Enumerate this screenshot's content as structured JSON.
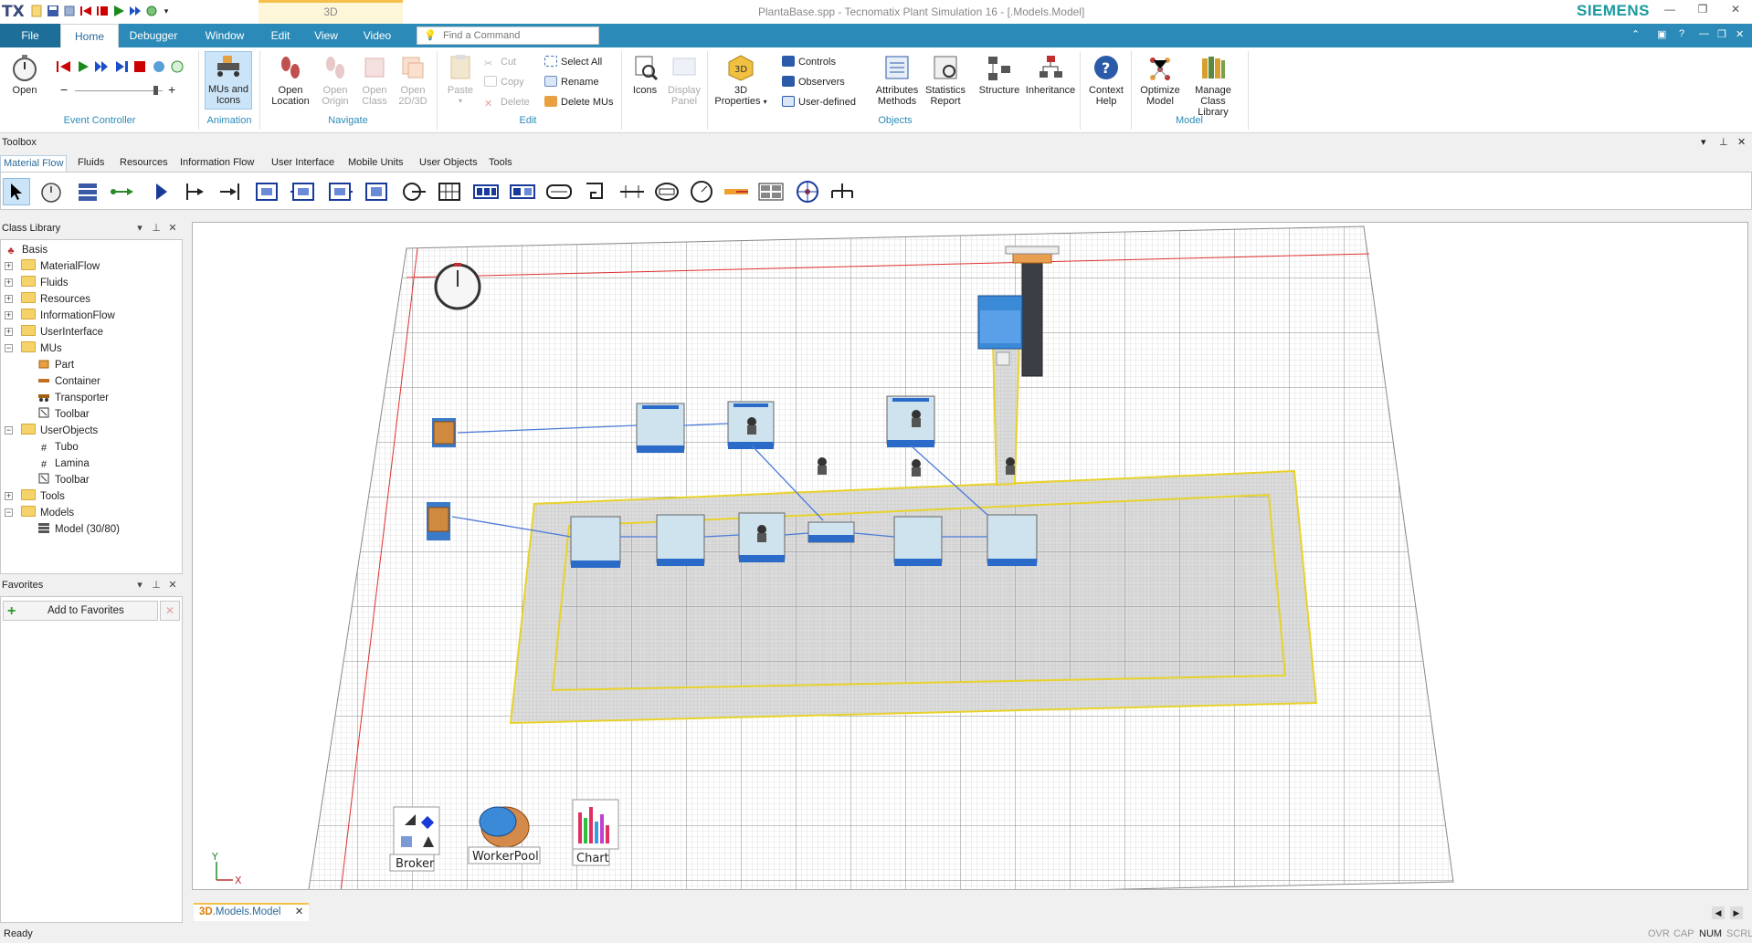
{
  "titlebar": {
    "app_logo": "TX",
    "context_tab": "3D",
    "window_title": "PlantaBase.spp - Tecnomatix Plant Simulation 16 - [.Models.Model]",
    "brand": "SIEMENS",
    "buttons": [
      "minimize",
      "maximize",
      "close"
    ]
  },
  "ribbon_tabs": [
    {
      "label": "File"
    },
    {
      "label": "Home"
    },
    {
      "label": "Debugger"
    },
    {
      "label": "Window"
    },
    {
      "label": "Edit"
    },
    {
      "label": "View"
    },
    {
      "label": "Video"
    }
  ],
  "find_command": {
    "placeholder": "Find a Command"
  },
  "ribbon": {
    "event_controller": {
      "open_label": "Open",
      "group_label": "Event Controller"
    },
    "animation": {
      "mus_label_1": "MUs and",
      "mus_label_2": "Icons",
      "group_label": "Animation"
    },
    "navigate": {
      "open_location_1": "Open",
      "open_location_2": "Location",
      "open_origin_1": "Open",
      "open_origin_2": "Origin",
      "open_class_1": "Open",
      "open_class_2": "Class",
      "open_2d3d_1": "Open",
      "open_2d3d_2": "2D/3D",
      "group_label": "Navigate"
    },
    "edit": {
      "paste": "Paste",
      "cut": "Cut",
      "copy": "Copy",
      "delete": "Delete",
      "select_all": "Select All",
      "rename": "Rename",
      "delete_mus": "Delete MUs",
      "group_label": "Edit"
    },
    "icons_group": {
      "icons": "Icons",
      "display_panel_1": "Display",
      "display_panel_2": "Panel"
    },
    "objects": {
      "props_1": "3D",
      "props_2": "Properties",
      "controls": "Controls",
      "observers": "Observers",
      "user_defined": "User-defined",
      "attr_1": "Attributes",
      "attr_2": "Methods",
      "stats_1": "Statistics",
      "stats_2": "Report",
      "structure": "Structure",
      "inheritance": "Inheritance",
      "group_label": "Objects"
    },
    "help": {
      "ctx_1": "Context",
      "ctx_2": "Help"
    },
    "model": {
      "opt_1": "Optimize",
      "opt_2": "Model",
      "mcl_1": "Manage",
      "mcl_2": "Class Library",
      "group_label": "Model"
    }
  },
  "toolbox": {
    "title": "Toolbox",
    "tabs": [
      "Material Flow",
      "Fluids",
      "Resources",
      "Information Flow",
      "User Interface",
      "Mobile Units",
      "User Objects",
      "Tools"
    ]
  },
  "class_library": {
    "title": "Class Library",
    "items": [
      {
        "label": "Basis"
      },
      {
        "label": "MaterialFlow"
      },
      {
        "label": "Fluids"
      },
      {
        "label": "Resources"
      },
      {
        "label": "InformationFlow"
      },
      {
        "label": "UserInterface"
      },
      {
        "label": "MUs"
      },
      {
        "label": "Part"
      },
      {
        "label": "Container"
      },
      {
        "label": "Transporter"
      },
      {
        "label": "Toolbar"
      },
      {
        "label": "UserObjects"
      },
      {
        "label": "Tubo"
      },
      {
        "label": "Lamina"
      },
      {
        "label": "Toolbar"
      },
      {
        "label": "Tools"
      },
      {
        "label": "Models"
      },
      {
        "label": "Model (30/80)"
      }
    ]
  },
  "favorites": {
    "title": "Favorites",
    "add_label": "Add to Favorites"
  },
  "canvas": {
    "labels": {
      "broker": "Broker",
      "workerpool": "WorkerPool",
      "chart": "Chart"
    },
    "axis": {
      "y": "Y",
      "x": "X"
    }
  },
  "doc_tab": {
    "prefix": "3D",
    "label": ".Models.Model"
  },
  "status": {
    "text": "Ready",
    "indicators": [
      "OVR",
      "CAP",
      "NUM",
      "SCRL"
    ]
  }
}
